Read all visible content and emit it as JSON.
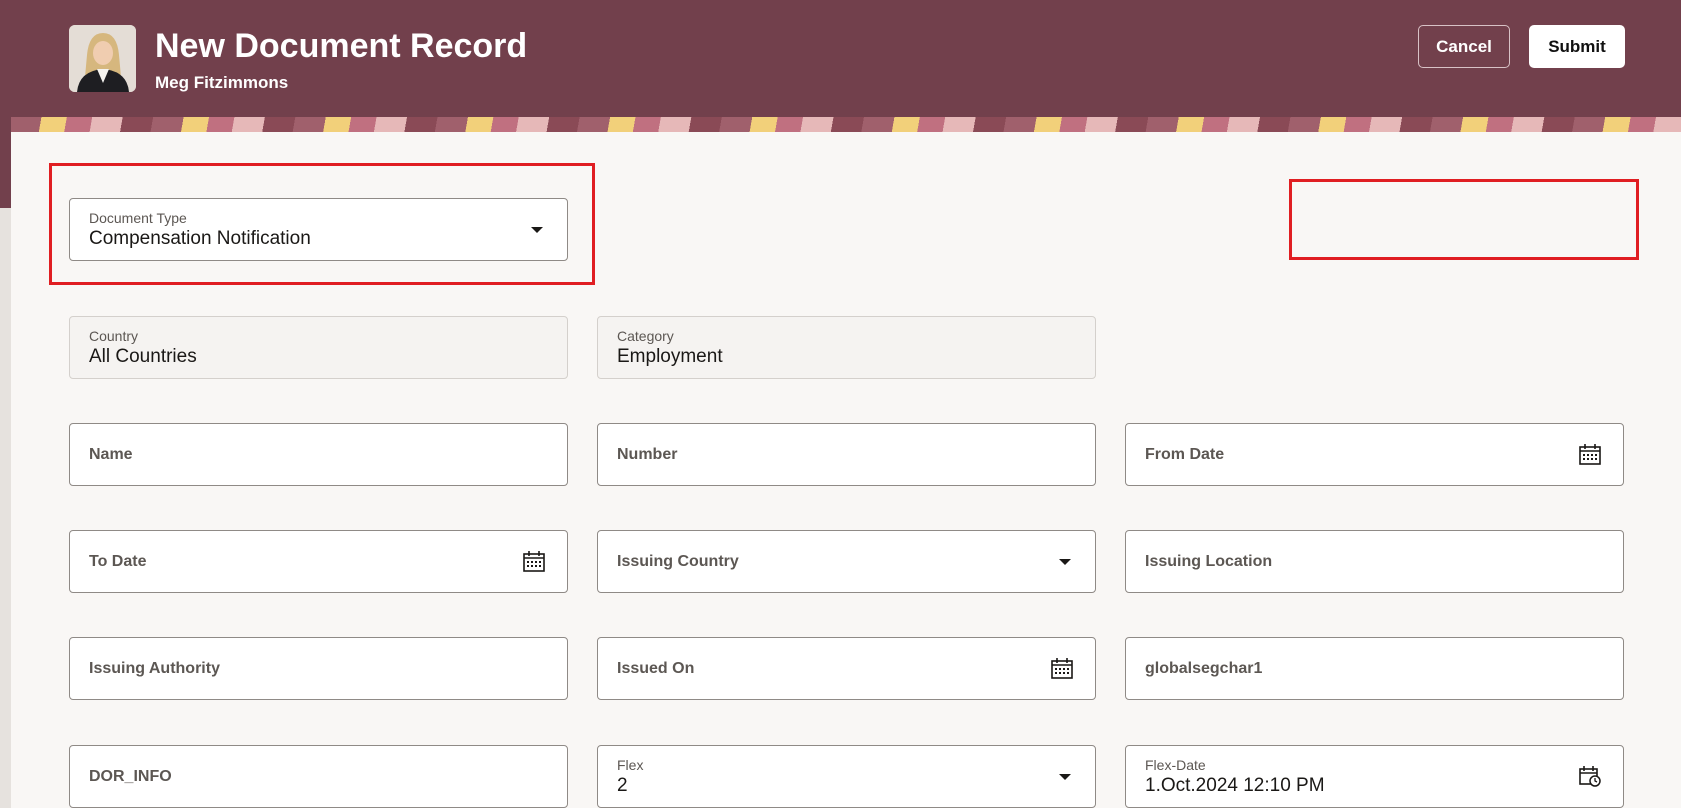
{
  "header": {
    "title": "New Document Record",
    "subtitle": "Meg Fitzimmons",
    "cancel_label": "Cancel",
    "submit_label": "Submit"
  },
  "colors": {
    "header_bg": "#72404c",
    "highlight": "#e01e22",
    "panel_bg": "#f9f7f5"
  },
  "form": {
    "document_type": {
      "label": "Document Type",
      "value": "Compensation Notification",
      "icon": "chevron-down-icon"
    },
    "country": {
      "label": "Country",
      "value": "All Countries"
    },
    "category": {
      "label": "Category",
      "value": "Employment"
    },
    "name": {
      "label": "Name"
    },
    "number": {
      "label": "Number"
    },
    "from_date": {
      "label": "From Date",
      "icon": "calendar-icon"
    },
    "to_date": {
      "label": "To Date",
      "icon": "calendar-icon"
    },
    "issuing_country": {
      "label": "Issuing Country",
      "icon": "chevron-down-icon"
    },
    "issuing_location": {
      "label": "Issuing Location"
    },
    "issuing_authority": {
      "label": "Issuing Authority"
    },
    "issued_on": {
      "label": "Issued On",
      "icon": "calendar-icon"
    },
    "globalsegchar1": {
      "label": "globalsegchar1"
    },
    "dor_info": {
      "label": "DOR_INFO"
    },
    "flex": {
      "label": "Flex",
      "value": "2",
      "icon": "chevron-down-icon"
    },
    "flex_date": {
      "label": "Flex-Date",
      "value": "1.Oct.2024 12:10 PM",
      "icon": "calendar-clock-icon"
    }
  }
}
